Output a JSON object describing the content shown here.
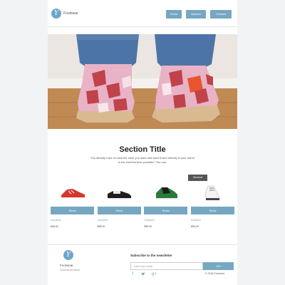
{
  "header": {
    "logo_letter": "Y",
    "brand": "Footwear",
    "nav": [
      {
        "label": "Home"
      },
      {
        "label": "Women"
      },
      {
        "label": "Contact"
      }
    ]
  },
  "hero": {
    "image": "pink-geometric-desert-boots"
  },
  "section": {
    "title": "Section Title",
    "description": "You already have in mind the shoe you want and want it sent directly to your home in the shortest time possible? You can.",
    "aside_button": "Shortcut"
  },
  "products": [
    {
      "image": "red-sneaker",
      "button": "Show",
      "name": "Sneakers",
      "price": "€65.00"
    },
    {
      "image": "black-white-derby-shoe",
      "button": "Show",
      "name": "Sneakers",
      "price": "€55.00"
    },
    {
      "image": "green-black-sneaker",
      "button": "Show",
      "name": "Sneakers",
      "price": "€55.00"
    },
    {
      "image": "white-running-shoe",
      "button": "Show",
      "name": "Rosalind",
      "price": "€55.00"
    }
  ],
  "footer": {
    "logo_letter": "Y",
    "brand": "Footwear",
    "tagline": "Good shoes since",
    "newsletter_title": "Subscribe to the newsletter",
    "email_placeholder": "Insert your email",
    "go_label": "GO",
    "social": [
      "facebook-icon",
      "twitter-icon",
      "google-plus-icon"
    ],
    "copyright": "© 2016 Footwear"
  },
  "colors": {
    "accent": "#76a7c2",
    "logo": "#6fa6c8",
    "background": "#f2f3f5"
  }
}
